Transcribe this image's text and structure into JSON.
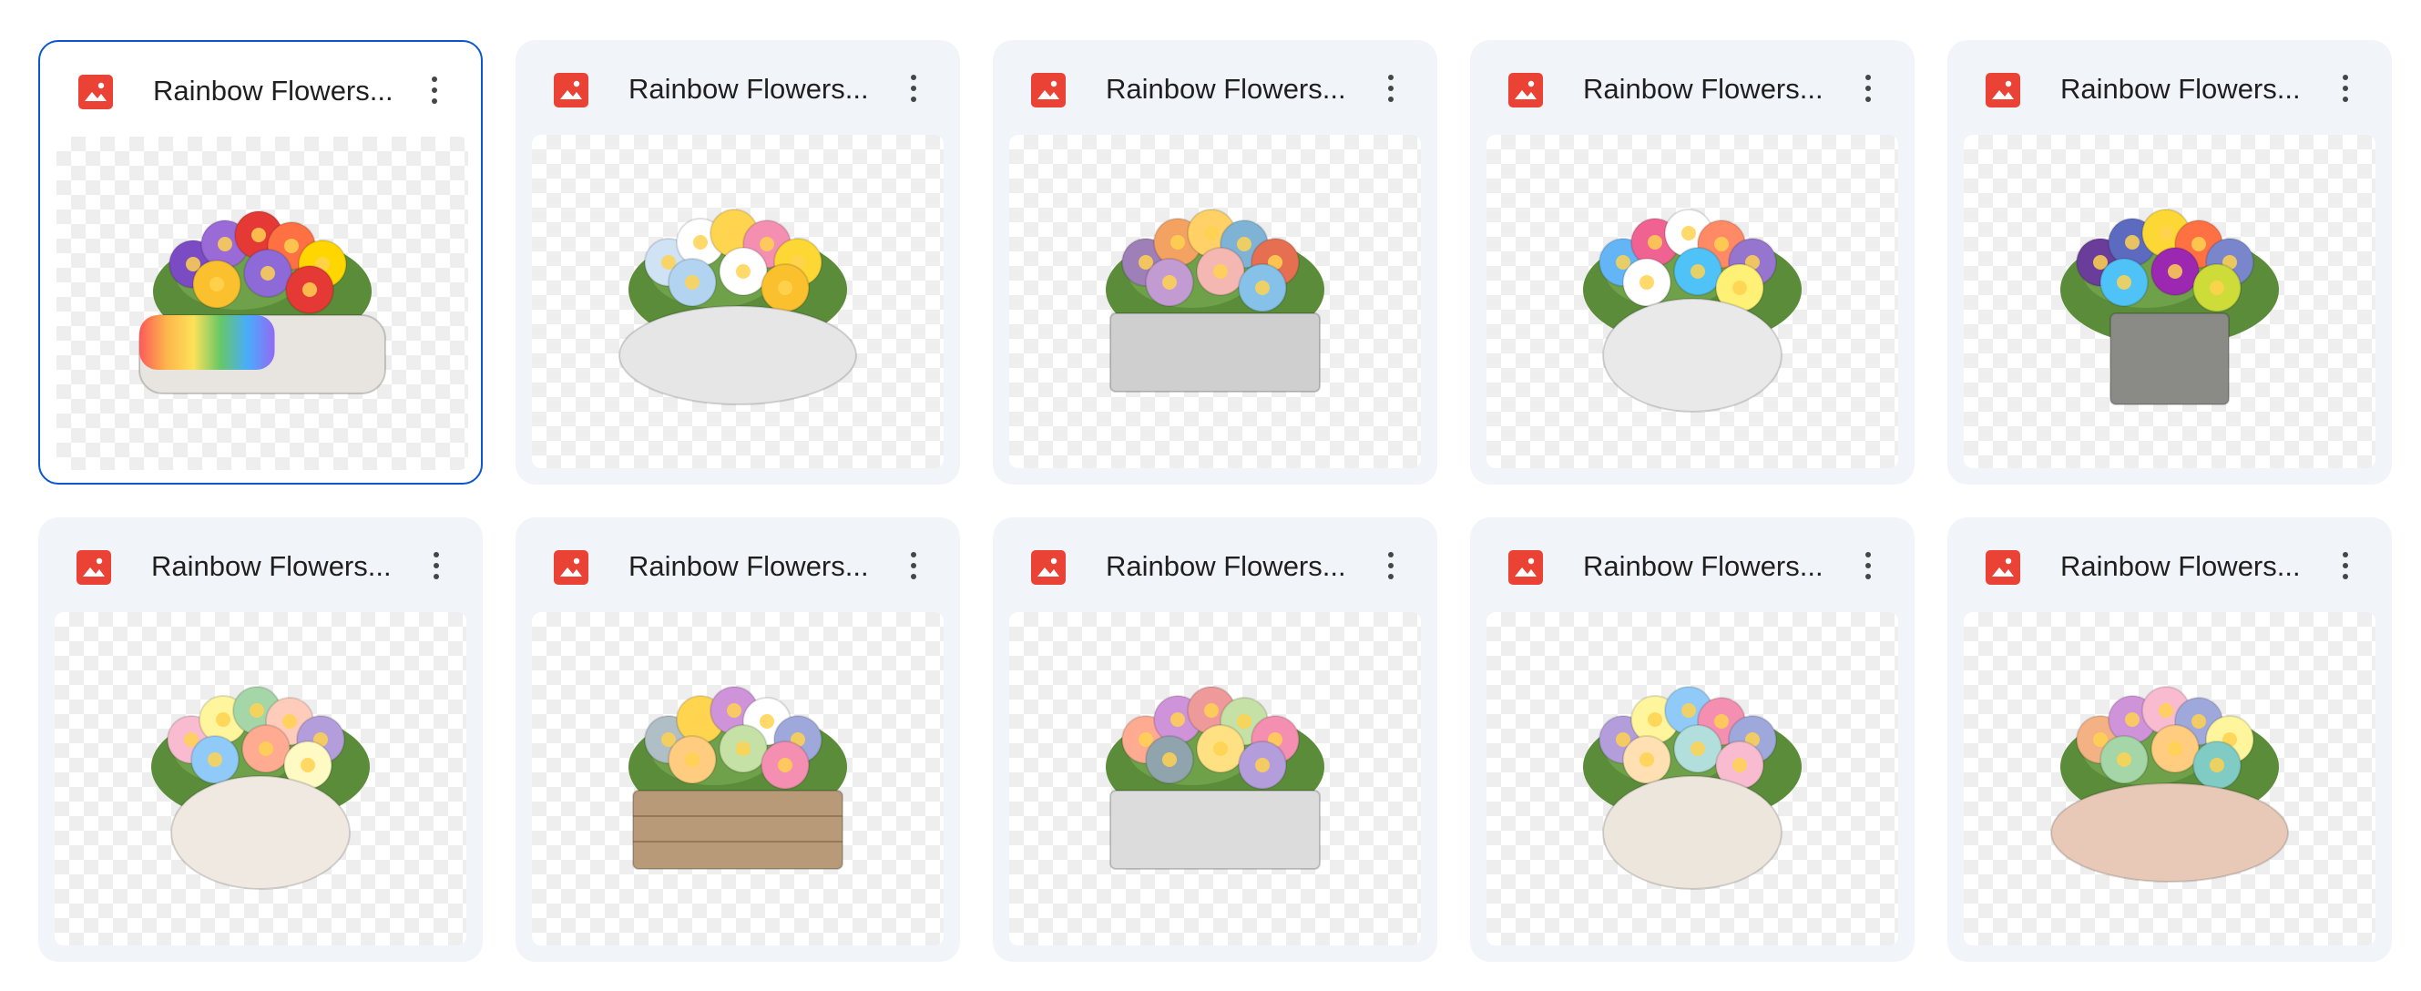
{
  "files": [
    {
      "name": "Rainbow Flowers...",
      "file_icon": "image-file-icon",
      "menu_icon": "more-vert-icon",
      "selected": true,
      "planter": "rock",
      "pot_color": "#e8e4e0",
      "flowers": [
        "#7b4bc4",
        "#9a6ad6",
        "#e53935",
        "#ff7043",
        "#ffd600",
        "#fbc02d",
        "#8e6ad8",
        "#e53935"
      ]
    },
    {
      "name": "Rainbow Flowers...",
      "file_icon": "image-file-icon",
      "menu_icon": "more-vert-icon",
      "selected": false,
      "planter": "bowl",
      "pot_color": "#e6e6e6",
      "flowers": [
        "#cfe3f5",
        "#ffffff",
        "#ffd54f",
        "#f48fb1",
        "#fdd835",
        "#b3d4f0",
        "#ffffff",
        "#fbc02d"
      ]
    },
    {
      "name": "Rainbow Flowers...",
      "file_icon": "image-file-icon",
      "menu_icon": "more-vert-icon",
      "selected": false,
      "planter": "box-marble",
      "pot_color": "#cfcfcf",
      "flowers": [
        "#9e7fb8",
        "#f4a261",
        "#ffd166",
        "#7fb3d5",
        "#e76f51",
        "#c39bd3",
        "#f5b7b1",
        "#85c1e9"
      ]
    },
    {
      "name": "Rainbow Flowers...",
      "file_icon": "image-file-icon",
      "menu_icon": "more-vert-icon",
      "selected": false,
      "planter": "round",
      "pot_color": "#e9e9ea",
      "flowers": [
        "#64b5f6",
        "#f06292",
        "#ffffff",
        "#ff8a65",
        "#9575cd",
        "#ffffff",
        "#4fc3f7",
        "#fff176"
      ]
    },
    {
      "name": "Rainbow Flowers...",
      "file_icon": "image-file-icon",
      "menu_icon": "more-vert-icon",
      "selected": false,
      "planter": "cube",
      "pot_color": "#8a8a86",
      "flowers": [
        "#6a3d9a",
        "#5c6bc0",
        "#fdd835",
        "#ff7043",
        "#7986cb",
        "#4fc3f7",
        "#9c27b0",
        "#cddc39"
      ]
    },
    {
      "name": "Rainbow Flowers...",
      "file_icon": "image-file-icon",
      "menu_icon": "more-vert-icon",
      "selected": false,
      "planter": "round",
      "pot_color": "#efe9e1",
      "flowers": [
        "#f8bbd0",
        "#fff59d",
        "#a5d6a7",
        "#ffccbc",
        "#b39ddb",
        "#90caf9",
        "#ffab91",
        "#fff9c4"
      ]
    },
    {
      "name": "Rainbow Flowers...",
      "file_icon": "image-file-icon",
      "menu_icon": "more-vert-icon",
      "selected": false,
      "planter": "crate",
      "pot_color": "#b89a78",
      "flowers": [
        "#b0bec5",
        "#ffd54f",
        "#ce93d8",
        "#ffffff",
        "#9fa8da",
        "#ffcc80",
        "#c5e1a5",
        "#f48fb1"
      ]
    },
    {
      "name": "Rainbow Flowers...",
      "file_icon": "image-file-icon",
      "menu_icon": "more-vert-icon",
      "selected": false,
      "planter": "box-marble",
      "pot_color": "#dcdcdc",
      "flowers": [
        "#ffab91",
        "#ce93d8",
        "#ef9a9a",
        "#c5e1a5",
        "#f48fb1",
        "#90a4ae",
        "#ffe082",
        "#b39ddb"
      ]
    },
    {
      "name": "Rainbow Flowers...",
      "file_icon": "image-file-icon",
      "menu_icon": "more-vert-icon",
      "selected": false,
      "planter": "round",
      "pot_color": "#ece6dc",
      "flowers": [
        "#b39ddb",
        "#fff59d",
        "#90caf9",
        "#f48fb1",
        "#9fa8da",
        "#ffe0b2",
        "#b2dfdb",
        "#f8bbd0"
      ]
    },
    {
      "name": "Rainbow Flowers...",
      "file_icon": "image-file-icon",
      "menu_icon": "more-vert-icon",
      "selected": false,
      "planter": "bowl",
      "pot_color": "#e8c9b8",
      "flowers": [
        "#f4b183",
        "#ce93d8",
        "#f8bbd0",
        "#9fa8da",
        "#fff59d",
        "#a5d6a7",
        "#ffcc80",
        "#80cbc4"
      ]
    }
  ],
  "colors": {
    "card_bg": "#f1f4f9",
    "selected_border": "#0b57d0",
    "file_icon_red": "#ea4335",
    "title_text": "#1f1f1f"
  }
}
